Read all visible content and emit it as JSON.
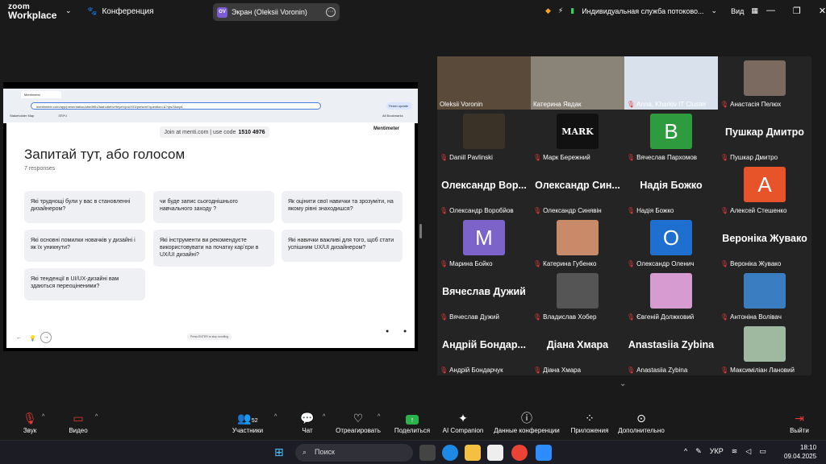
{
  "app": {
    "logo_line1": "zoom",
    "logo_line2": "Workplace",
    "conference_label": "Конференция",
    "screen_share_label": "Экран (Oleksii Voronin)",
    "screen_avatar": "OV",
    "support_label": "Индивидуальная служба потоково...",
    "view_label": "Вид"
  },
  "browser": {
    "tab_title": "Mentimeter",
    "url": "mentimeter.com/app/presentation/alrw3f6h/3aahu6ehvr9eyeh/yvuXX3/present?question=&?qrs/XkwyA",
    "finish_update": "Finish update",
    "bookmark1": "Stakeholder Map",
    "bookmark2": "ЗПУЧ",
    "all_bookmarks": "All Bookmarks"
  },
  "slide": {
    "join_text": "Join at menti.com | use code",
    "code": "1510 4976",
    "brand": "Mentimeter",
    "question": "Запитай тут, або голосом",
    "responses": "7 responses",
    "hint": "Press ENTER to stop scrolling",
    "cards": [
      "Які труднощі були у вас в становленні дизайнером?",
      "чи буде запис сьогоднішнього навчального заходу ?",
      "Як оцінити свої навички та зрозуміти, на якому рівні знаходишся?",
      "Які основні помилки новачків у дизайні і як їх уникнути?",
      "Які інструменти ви рекомендуєте використовувати на початку карʼєри в UX/UI дизайні?",
      "Які навички важливі для того, щоб стати успішним UX/UI дизайнером?",
      "Які тенденції в UI/UX-дизайні вам здаються переоціненими?"
    ]
  },
  "participants": [
    {
      "name": "Oleksii Voronin",
      "muted": false,
      "kind": "video",
      "color": "#5a4a3a"
    },
    {
      "name": "Катерина Явдак",
      "muted": false,
      "kind": "video",
      "color": "#8a8378"
    },
    {
      "name": "Anna, Kharkiv IT Cluster",
      "muted": true,
      "kind": "video",
      "color": "#d9e2ec"
    },
    {
      "name": "Анастасія Пелюх",
      "muted": true,
      "kind": "photo",
      "color": "#7a6a60"
    },
    {
      "name": "Daniil Pavlinski",
      "muted": true,
      "kind": "photo",
      "color": "#3a3226"
    },
    {
      "name": "Марк Бережний",
      "muted": true,
      "kind": "photo",
      "color": "#111111",
      "text": "MARK"
    },
    {
      "name": "Вячеслав Пархомов",
      "muted": true,
      "kind": "letter",
      "letter": "B",
      "color": "#2e9b3f"
    },
    {
      "name": "Пушкар Дмитро",
      "muted": true,
      "kind": "bigname",
      "big": "Пушкар Дмитро"
    },
    {
      "name": "Олександр Воробйов",
      "muted": true,
      "kind": "bigname",
      "big": "Олександр Вор..."
    },
    {
      "name": "Олександр Синявін",
      "muted": true,
      "kind": "bigname",
      "big": "Олександр Син..."
    },
    {
      "name": "Надія Божко",
      "muted": true,
      "kind": "bigname",
      "big": "Надія Божко"
    },
    {
      "name": "Алексей Стешенко",
      "muted": true,
      "kind": "letter",
      "letter": "A",
      "color": "#e8542a"
    },
    {
      "name": "Марина Бойко",
      "muted": true,
      "kind": "letter",
      "letter": "M",
      "color": "#7b63c9"
    },
    {
      "name": "Катерина Губенко",
      "muted": true,
      "kind": "photo",
      "color": "#c98a6a"
    },
    {
      "name": "Олександр Оленич",
      "muted": true,
      "kind": "letter",
      "letter": "O",
      "color": "#1f6fd1"
    },
    {
      "name": "Вероніка Жувако",
      "muted": true,
      "kind": "bigname",
      "big": "Вероніка Жувако"
    },
    {
      "name": "Вячеслав Дужий",
      "muted": true,
      "kind": "bigname",
      "big": "Вячеслав Дужий"
    },
    {
      "name": "Владислав Хобер",
      "muted": true,
      "kind": "photo",
      "color": "#555555"
    },
    {
      "name": "Євгеній Должковий",
      "muted": true,
      "kind": "photo",
      "color": "#d69bd0"
    },
    {
      "name": "Антоніна Волівач",
      "muted": true,
      "kind": "photo",
      "color": "#3a7dc0"
    },
    {
      "name": "Андрій Бондарчук",
      "muted": true,
      "kind": "bigname",
      "big": "Андрій Бондар..."
    },
    {
      "name": "Діана Хмара",
      "muted": true,
      "kind": "bigname",
      "big": "Діана Хмара"
    },
    {
      "name": "Anastasiia Zybina",
      "muted": true,
      "kind": "bigname",
      "big": "Anastasiia Zybina"
    },
    {
      "name": "Максиміліан Лановий",
      "muted": true,
      "kind": "photo",
      "color": "#9fb9a0"
    }
  ],
  "toolbar": {
    "audio": "Звук",
    "video": "Видео",
    "participants": "Участники",
    "participants_count": "52",
    "chat": "Чат",
    "react": "Отреагировать",
    "share": "Поделиться",
    "ai": "AI Companion",
    "info": "Данные конференции",
    "apps": "Приложения",
    "more": "Дополнительно",
    "leave": "Выйти"
  },
  "taskbar": {
    "search": "Поиск",
    "lang": "УКР",
    "time": "18:10",
    "date": "09.04.2025"
  }
}
